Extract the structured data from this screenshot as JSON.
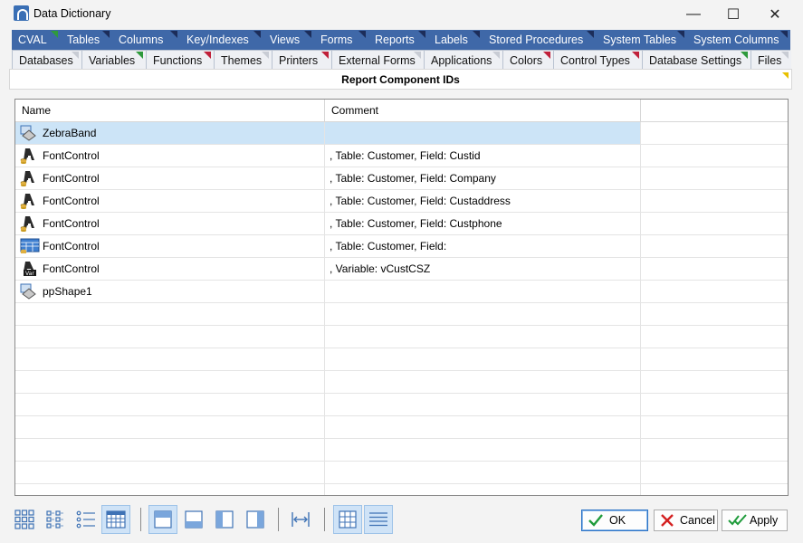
{
  "window": {
    "title": "Data Dictionary",
    "minimize": "—",
    "maximize": "☐",
    "close": "✕"
  },
  "tabs_row1": [
    {
      "label": "CVAL",
      "tri": "green"
    },
    {
      "label": "Tables",
      "tri": "navy"
    },
    {
      "label": "Columns",
      "tri": "navy"
    },
    {
      "label": "Key/Indexes",
      "tri": "navy"
    },
    {
      "label": "Views",
      "tri": "navy"
    },
    {
      "label": "Forms",
      "tri": "navy"
    },
    {
      "label": "Reports",
      "tri": "navy"
    },
    {
      "label": "Labels",
      "tri": "navy"
    },
    {
      "label": "Stored Procedures",
      "tri": "navy"
    },
    {
      "label": "System Tables",
      "tri": "navy"
    },
    {
      "label": "System Columns",
      "tri": "navy"
    }
  ],
  "tabs_row2": [
    {
      "label": "Databases",
      "tri": "gray"
    },
    {
      "label": "Variables",
      "tri": "green"
    },
    {
      "label": "Functions",
      "tri": "red"
    },
    {
      "label": "Themes",
      "tri": "gray"
    },
    {
      "label": "Printers",
      "tri": "red"
    },
    {
      "label": "External Forms",
      "tri": "gray"
    },
    {
      "label": "Applications",
      "tri": "gray"
    },
    {
      "label": "Colors",
      "tri": "red"
    },
    {
      "label": "Control Types",
      "tri": "red"
    },
    {
      "label": "Database Settings",
      "tri": "green"
    },
    {
      "label": "Files",
      "tri": "gray"
    }
  ],
  "panel": {
    "caption": "Report Component IDs"
  },
  "grid": {
    "columns": [
      "Name",
      "Comment"
    ],
    "rows": [
      {
        "name": "ZebraBand",
        "comment": "",
        "icon": "shape-icon",
        "selected": true
      },
      {
        "name": "FontControl",
        "comment": ", Table: Customer, Field: Custid",
        "icon": "font-db-icon",
        "selected": false
      },
      {
        "name": "FontControl",
        "comment": ", Table: Customer, Field: Company",
        "icon": "font-db-icon",
        "selected": false
      },
      {
        "name": "FontControl",
        "comment": ", Table: Customer, Field: Custaddress",
        "icon": "font-db-icon",
        "selected": false
      },
      {
        "name": "FontControl",
        "comment": ", Table: Customer, Field: Custphone",
        "icon": "font-db-icon",
        "selected": false
      },
      {
        "name": "FontControl",
        "comment": ", Table: Customer, Field:",
        "icon": "grid-db-icon",
        "selected": false
      },
      {
        "name": "FontControl",
        "comment": ", Variable: vCustCSZ",
        "icon": "font-var-icon",
        "selected": false
      },
      {
        "name": "ppShape1",
        "comment": "",
        "icon": "shape-icon",
        "selected": false
      }
    ],
    "blank_rows": 9
  },
  "toolbar": {
    "icons": [
      "large-icons-view-icon",
      "small-icons-view-icon",
      "list-view-icon",
      "details-view-icon",
      "layout-top-icon",
      "layout-bottom-icon",
      "layout-left-icon",
      "layout-right-icon",
      "fit-width-icon",
      "grid-lines-icon",
      "row-lines-icon"
    ]
  },
  "buttons": {
    "ok": "OK",
    "cancel": "Cancel",
    "apply": "Apply"
  },
  "colors": {
    "tab_bar": "#3f68a8",
    "selection": "#cce4f7",
    "ok_check": "#1e9b3a",
    "cancel_x": "#d42020"
  }
}
